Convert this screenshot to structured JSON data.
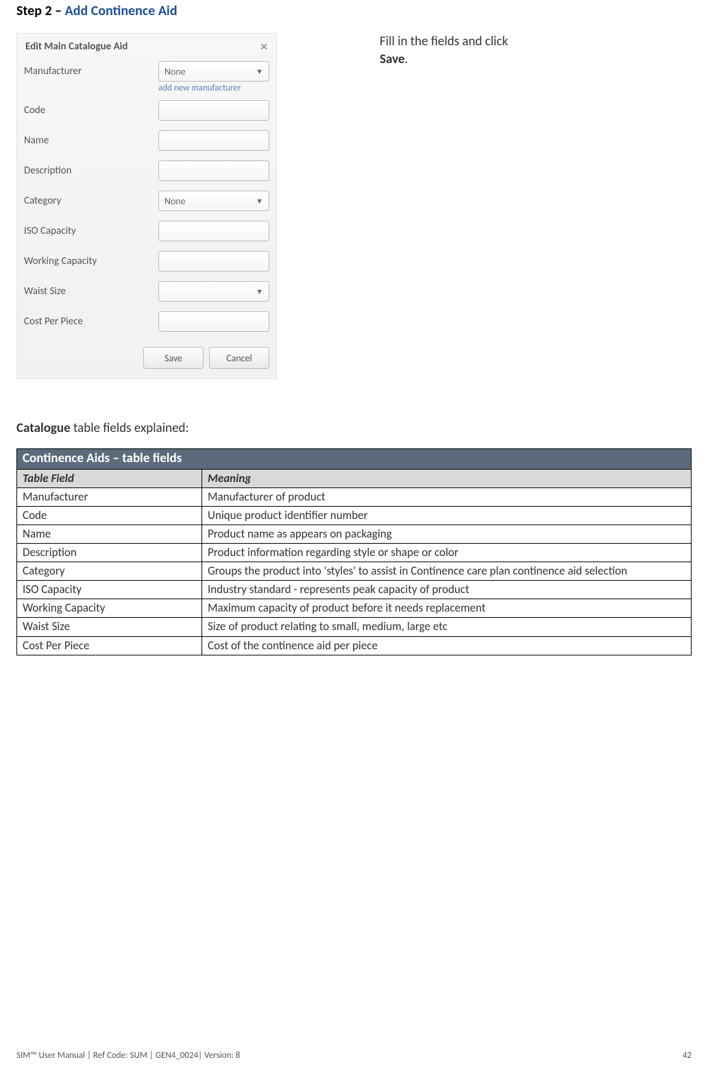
{
  "heading": {
    "prefix": "Step 2",
    "sep": " – ",
    "title": "Add Continence Aid"
  },
  "side_text": {
    "line1": "Fill in the fields and click ",
    "save_word": "Save",
    "period": "."
  },
  "dialog": {
    "title": "Edit Main Catalogue Aid",
    "close_glyph": "✕",
    "add_new_link": "add new manufacturer",
    "labels": {
      "manufacturer": "Manufacturer",
      "code": "Code",
      "name": "Name",
      "description": "Description",
      "category": "Category",
      "iso": "ISO Capacity",
      "working": "Working Capacity",
      "waist": "Waist Size",
      "cost": "Cost Per Piece"
    },
    "selects": {
      "manufacturer_value": "None",
      "category_value": "None",
      "waist_value": ""
    },
    "buttons": {
      "save": "Save",
      "cancel": "Cancel"
    }
  },
  "catalogue_intro": {
    "bold": "Catalogue",
    "rest": " table fields explained:"
  },
  "table": {
    "title": "Continence Aids – table fields",
    "col1": "Table Field",
    "col2": "Meaning",
    "rows": [
      {
        "field": "Manufacturer",
        "meaning": "Manufacturer of product"
      },
      {
        "field": "Code",
        "meaning": "Unique product identifier number"
      },
      {
        "field": "Name",
        "meaning": "Product name as appears on packaging"
      },
      {
        "field": "Description",
        "meaning": "Product information regarding style or shape or color"
      },
      {
        "field": "Category",
        "meaning": "Groups the product into 'styles' to assist in Continence care plan continence aid selection"
      },
      {
        "field": "ISO Capacity",
        "meaning": "Industry standard - represents peak capacity of product"
      },
      {
        "field": "Working Capacity",
        "meaning": "Maximum capacity of product before it needs replacement"
      },
      {
        "field": "Waist Size",
        "meaning": "Size of product relating to small, medium, large etc"
      },
      {
        "field": "Cost Per Piece",
        "meaning": "Cost of the continence aid per piece"
      }
    ]
  },
  "footer": {
    "left": "SIM™ User Manual | Ref Code: SUM | GEN4_0024| Version: 8",
    "right": "42"
  }
}
